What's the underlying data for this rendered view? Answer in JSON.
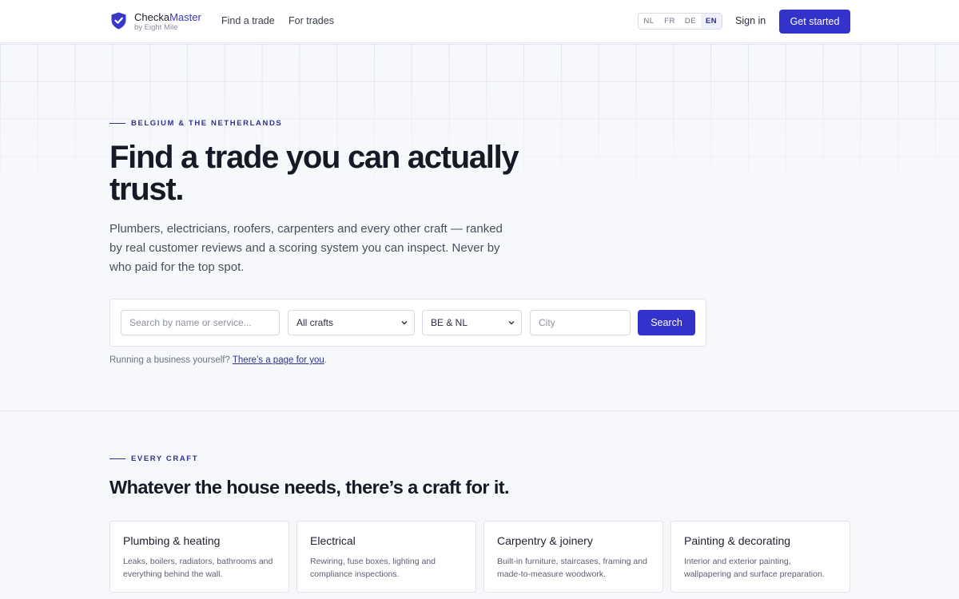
{
  "brand": {
    "name_main": "Checka",
    "name_accent": "Master",
    "sub": "by Eight Mile"
  },
  "nav": {
    "find_trade": "Find a trade",
    "for_trades": "For trades"
  },
  "languages": [
    "NL",
    "FR",
    "DE",
    "EN"
  ],
  "active_language": "EN",
  "header_actions": {
    "sign_in": "Sign in",
    "get_started": "Get started"
  },
  "hero": {
    "eyebrow": "BELGIUM & THE NETHERLANDS",
    "title": "Find a trade you can actually trust.",
    "lead": "Plumbers, electricians, roofers, carpenters and every other craft — ranked by real customer reviews and a scoring system you can inspect. Never by who paid for the top spot."
  },
  "search": {
    "query_placeholder": "Search by name or service...",
    "craft_selected": "All crafts",
    "country_selected": "BE & NL",
    "city_placeholder": "City",
    "button": "Search"
  },
  "business": {
    "text": "Running a business yourself?",
    "link": "There’s a page for you",
    "suffix": "."
  },
  "crafts": {
    "eyebrow": "EVERY CRAFT",
    "title": "Whatever the house needs, there’s a craft for it.",
    "cards": [
      {
        "title": "Plumbing & heating",
        "desc": "Leaks, boilers, radiators, bathrooms and everything behind the wall."
      },
      {
        "title": "Electrical",
        "desc": "Rewiring, fuse boxes, lighting and compliance inspections."
      },
      {
        "title": "Carpentry & joinery",
        "desc": "Built-in furniture, staircases, framing and made-to-measure woodwork."
      },
      {
        "title": "Painting & decorating",
        "desc": "Interior and exterior painting, wallpapering and surface preparation."
      }
    ]
  },
  "colors": {
    "primary": "#3333cc",
    "eyebrow": "#2f3290",
    "background": "#f6f7fa"
  }
}
